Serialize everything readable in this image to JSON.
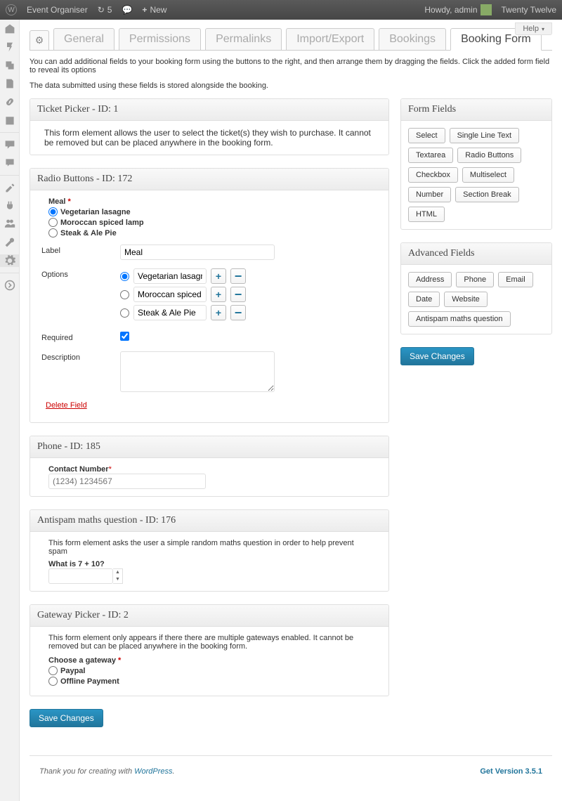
{
  "adminbar": {
    "site": "Event Organiser",
    "refresh": "5",
    "new": "New",
    "howdy": "Howdy, admin",
    "theme": "Twenty Twelve"
  },
  "help": "Help",
  "tabs": {
    "general": "General",
    "permissions": "Permissions",
    "permalinks": "Permalinks",
    "import_export": "Import/Export",
    "bookings": "Bookings",
    "booking_form": "Booking Form"
  },
  "intro1": "You can add additional fields to your booking form using the buttons to the right, and then arrange them by dragging the fields. Click the added form field to reveal its options",
  "intro2": "The data submitted using these fields is stored alongside the booking.",
  "ticket": {
    "title": "Ticket Picker - ID: 1",
    "desc": "This form element allows the user to select the ticket(s) they wish to purchase. It cannot be removed but can be placed anywhere in the booking form."
  },
  "radio": {
    "title": "Radio Buttons - ID: 172",
    "preview_label": "Meal",
    "opts": [
      "Vegetarian lasagne",
      "Moroccan spiced lamp",
      "Steak & Ale Pie"
    ],
    "label_lbl": "Label",
    "label_val": "Meal",
    "options_lbl": "Options",
    "option_vals": [
      "Vegetarian lasagne",
      "Moroccan spiced lamp",
      "Steak & Ale Pie"
    ],
    "required_lbl": "Required",
    "description_lbl": "Description",
    "delete": "Delete Field"
  },
  "phone": {
    "title": "Phone - ID: 185",
    "label": "Contact Number",
    "placeholder": "(1234) 1234567"
  },
  "antispam": {
    "title": "Antispam maths question - ID: 176",
    "desc": "This form element asks the user a simple random maths question in order to help prevent spam",
    "question": "What is 7 + 10?"
  },
  "gateway": {
    "title": "Gateway Picker - ID: 2",
    "desc": "This form element only appears if there there are multiple gateways enabled. It cannot be removed but can be placed anywhere in the booking form.",
    "label": "Choose a gateway",
    "opts": [
      "Paypal",
      "Offline Payment"
    ]
  },
  "form_fields": {
    "title": "Form Fields",
    "items": [
      "Select",
      "Single Line Text",
      "Textarea",
      "Radio Buttons",
      "Checkbox",
      "Multiselect",
      "Number",
      "Section Break",
      "HTML"
    ]
  },
  "adv_fields": {
    "title": "Advanced Fields",
    "items": [
      "Address",
      "Phone",
      "Email",
      "Date",
      "Website",
      "Antispam maths question"
    ]
  },
  "save": "Save Changes",
  "footer": {
    "thanks": "Thank you for creating with ",
    "wp": "WordPress",
    "version": "Get Version 3.5.1"
  }
}
